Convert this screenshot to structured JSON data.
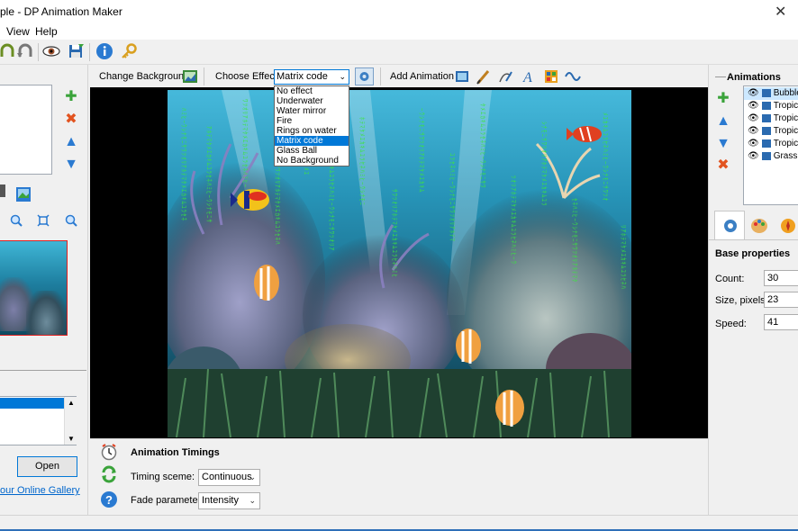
{
  "window": {
    "title": "ple - DP Animation Maker"
  },
  "menu": {
    "items": [
      "View",
      "Help"
    ]
  },
  "effect_bar": {
    "change_background_label": "Change Background",
    "choose_effect_label": "Choose Effect:",
    "selected_effect": "Matrix code",
    "add_animation_label": "Add Animation",
    "options": [
      "No effect",
      "Underwater",
      "Water mirror",
      "Fire",
      "Rings on water",
      "Matrix code",
      "Glass Ball",
      "No Background"
    ]
  },
  "left_panel": {
    "open_button": "Open",
    "gallery_link": "our Online Gallery"
  },
  "timings": {
    "title": "Animation Timings",
    "timing_scheme_label": "Timing sceme:",
    "timing_scheme_value": "Continuous",
    "fade_label": "Fade parameter:",
    "fade_value": "Intensity"
  },
  "right_panel": {
    "animations_title": "Animations",
    "animations": [
      "Bubble",
      "Tropic",
      "Tropic",
      "Tropic",
      "Tropic",
      "Grass"
    ],
    "base_properties_title": "Base properties",
    "count_label": "Count:",
    "count_value": "30",
    "size_label": "Size, pixels:",
    "size_value": "23",
    "speed_label": "Speed:",
    "speed_value": "41"
  },
  "colors": {
    "accent": "#0078d7",
    "water_top": "#2fa7c9",
    "water_bottom": "#0d3d52",
    "matrix_green": "#3ce63c"
  }
}
